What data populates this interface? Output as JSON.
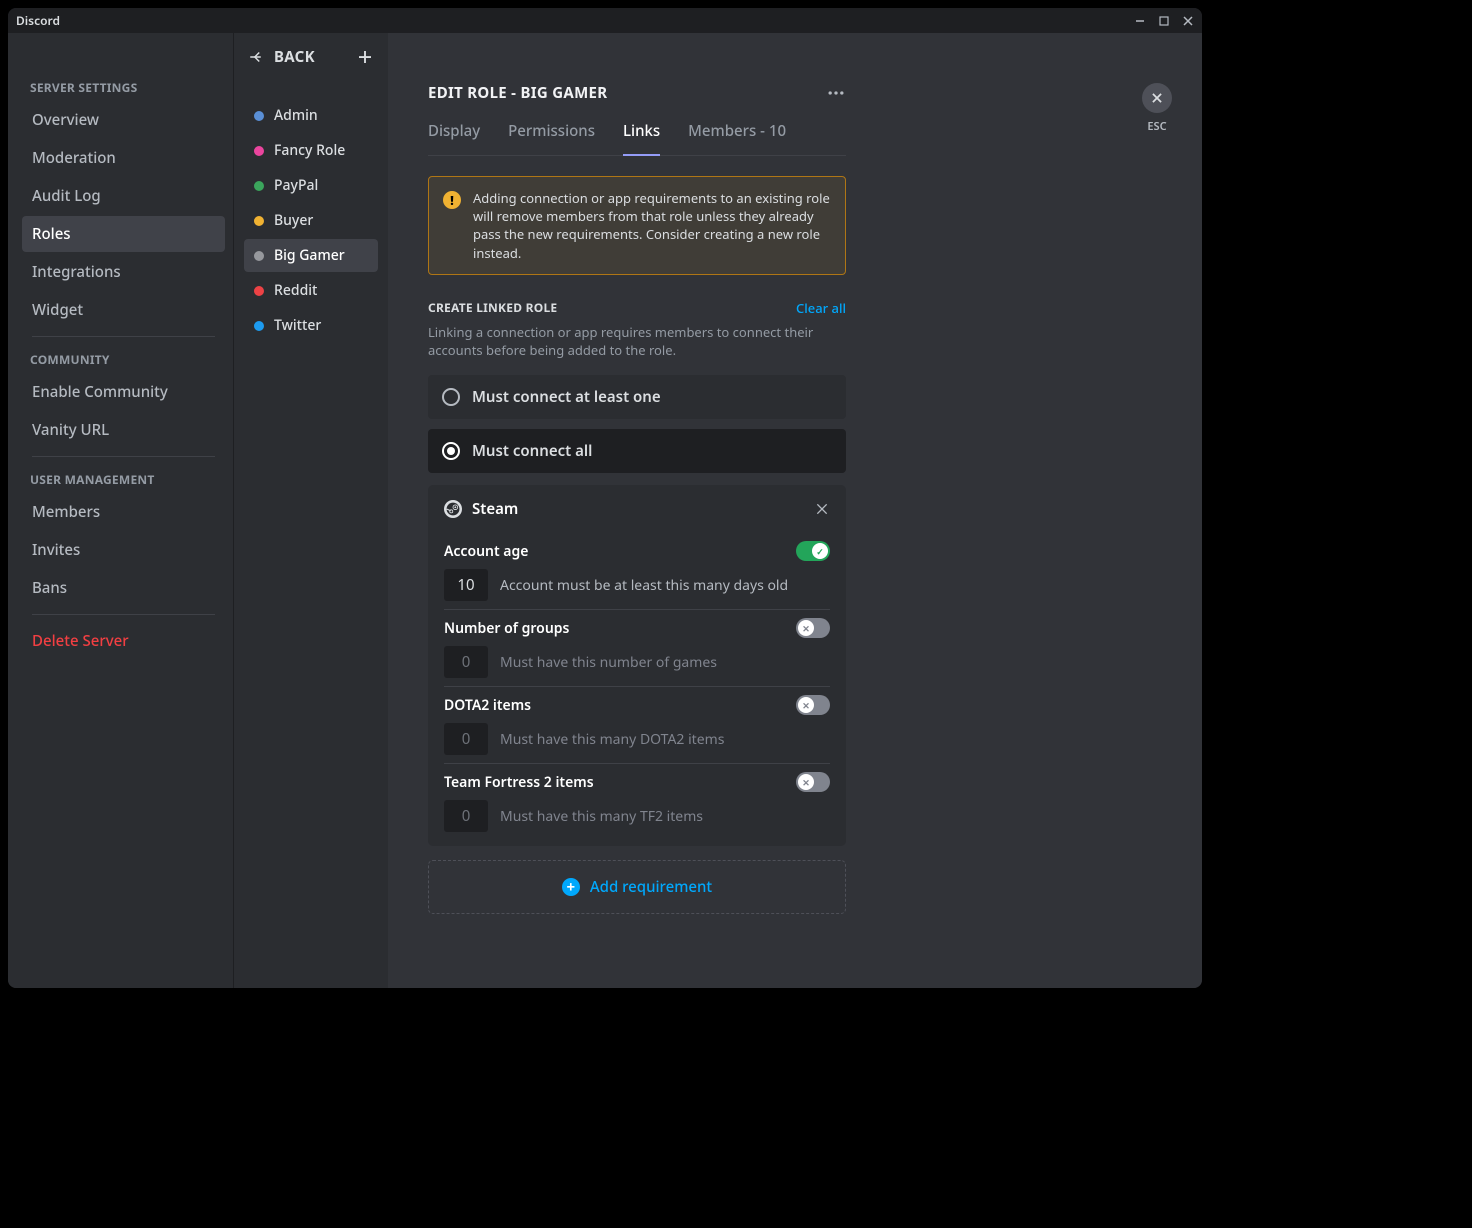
{
  "app": {
    "title": "Discord",
    "esc_label": "ESC"
  },
  "sidebar": {
    "heading_settings": "SERVER SETTINGS",
    "heading_community": "COMMUNITY",
    "heading_user_mgmt": "USER MANAGEMENT",
    "items_settings": [
      "Overview",
      "Moderation",
      "Audit Log",
      "Roles",
      "Integrations",
      "Widget"
    ],
    "items_community": [
      "Enable Community",
      "Vanity URL"
    ],
    "items_user": [
      "Members",
      "Invites",
      "Bans"
    ],
    "delete": "Delete Server",
    "selected": "Roles"
  },
  "roles_col": {
    "back": "BACK",
    "roles": [
      {
        "name": "Admin",
        "color": "#5a8fd6"
      },
      {
        "name": "Fancy Role",
        "color": "#eb459e"
      },
      {
        "name": "PayPal",
        "color": "#3ba55c"
      },
      {
        "name": "Buyer",
        "color": "#f0b232"
      },
      {
        "name": "Big Gamer",
        "color": "#96989d"
      },
      {
        "name": "Reddit",
        "color": "#ed4245"
      },
      {
        "name": "Twitter",
        "color": "#1d9bf0"
      }
    ],
    "selected": "Big Gamer"
  },
  "page": {
    "title": "EDIT ROLE  -  BIG GAMER",
    "tabs": [
      "Display",
      "Permissions",
      "Links",
      "Members - 10"
    ],
    "active_tab": "Links",
    "warning": "Adding connection or app requirements to an existing role will remove members from that role unless they already pass the new requirements. Consider creating a new role instead.",
    "section_title": "CREATE LINKED ROLE",
    "clear_all": "Clear all",
    "section_desc": "Linking a connection or app requires members to connect their accounts before being added to the role.",
    "radio_one": "Must connect at least one",
    "radio_all": "Must connect all"
  },
  "requirement": {
    "connection": "Steam",
    "fields": [
      {
        "label": "Account age",
        "value": "10",
        "desc": "Account must be at least this many days old",
        "on": true
      },
      {
        "label": "Number of groups",
        "value": "0",
        "desc": "Must have this number of games",
        "on": false
      },
      {
        "label": "DOTA2 items",
        "value": "0",
        "desc": "Must have this many DOTA2 items",
        "on": false
      },
      {
        "label": "Team Fortress 2 items",
        "value": "0",
        "desc": "Must have this many TF2 items",
        "on": false
      }
    ],
    "add": "Add requirement"
  }
}
